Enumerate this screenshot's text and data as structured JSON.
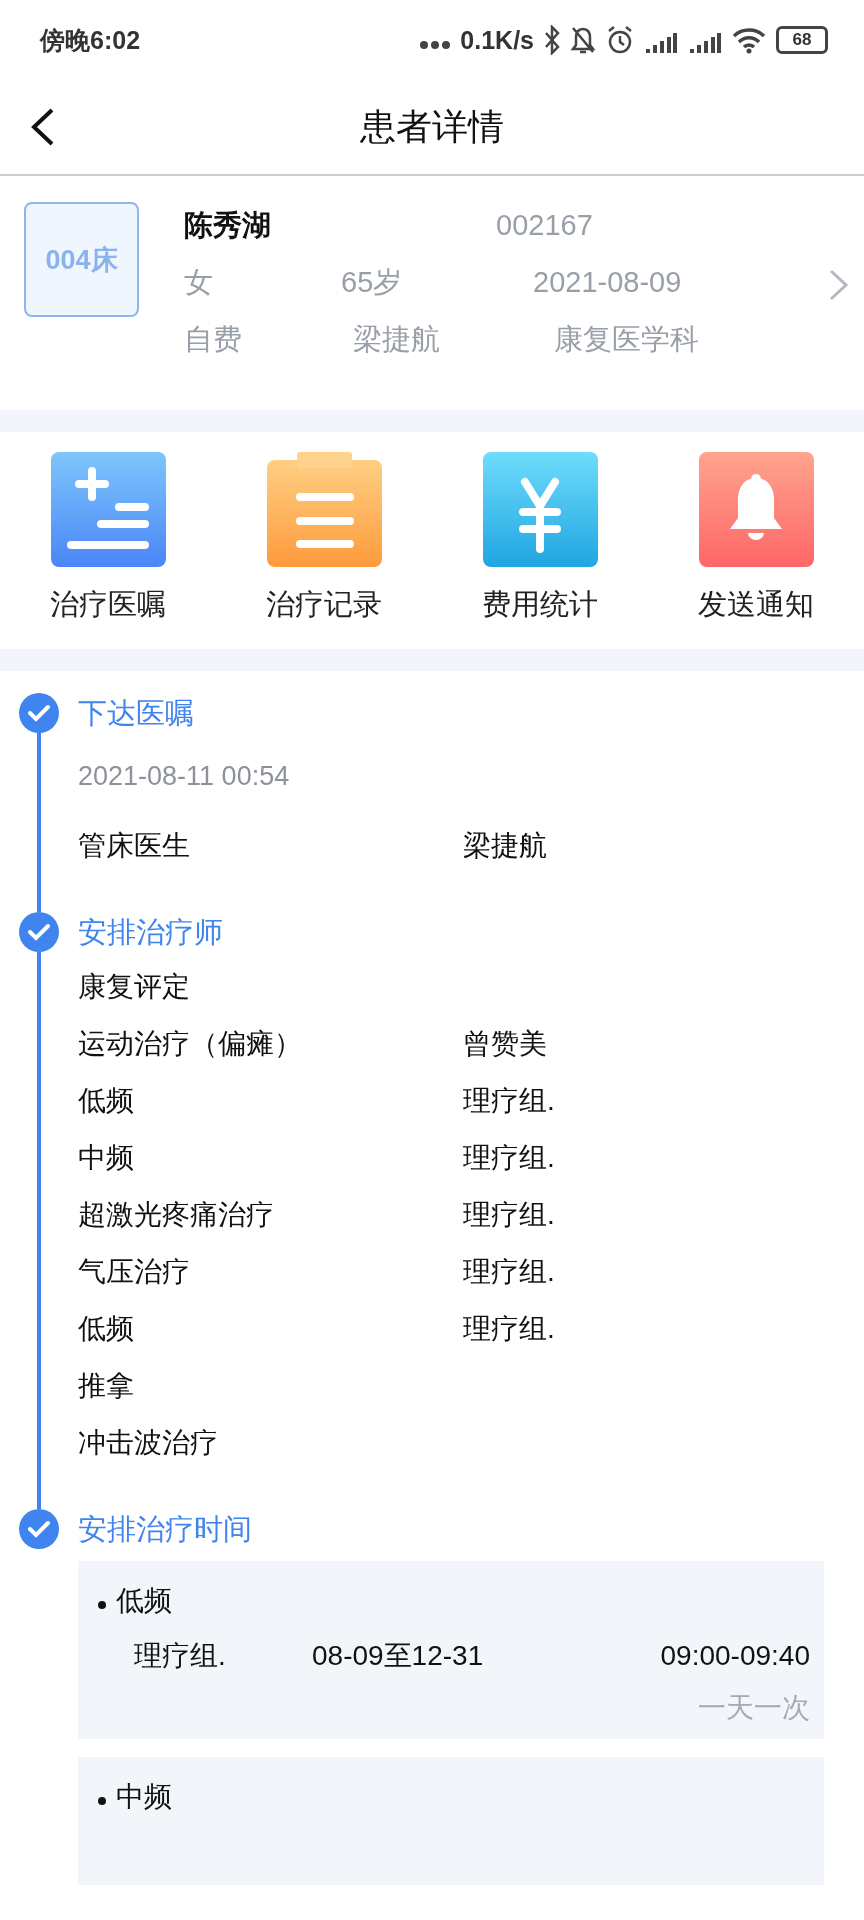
{
  "status_bar": {
    "time": "傍晚6:02",
    "net_speed": "0.1K/s",
    "battery": "68"
  },
  "header": {
    "title": "患者详情"
  },
  "patient": {
    "bed": "004床",
    "name": "陈秀湖",
    "id": "002167",
    "gender": "女",
    "age": "65岁",
    "admitted": "2021-08-09",
    "payment": "自费",
    "doctor": "梁捷航",
    "department": "康复医学科"
  },
  "actions": [
    {
      "label": "治疗医嘱",
      "kind": "orders"
    },
    {
      "label": "治疗记录",
      "kind": "records"
    },
    {
      "label": "费用统计",
      "kind": "fees"
    },
    {
      "label": "发送通知",
      "kind": "notify"
    }
  ],
  "timeline": [
    {
      "title": "下达医嘱",
      "completed": true,
      "date": "2021-08-11 00:54",
      "rows": [
        {
          "name": "管床医生",
          "value": "梁捷航"
        }
      ]
    },
    {
      "title": "安排治疗师",
      "completed": true,
      "rows": [
        {
          "name": "康复评定"
        },
        {
          "name": "运动治疗（偏瘫）",
          "value": "曾赞美"
        },
        {
          "name": "低频",
          "value": "理疗组."
        },
        {
          "name": "中频",
          "value": "理疗组."
        },
        {
          "name": "超激光疼痛治疗",
          "value": "理疗组."
        },
        {
          "name": "气压治疗",
          "value": "理疗组."
        },
        {
          "name": "低频",
          "value": "理疗组."
        },
        {
          "name": "推拿"
        },
        {
          "name": "冲击波治疗"
        }
      ]
    },
    {
      "title": "安排治疗时间",
      "completed": true,
      "schedules": [
        {
          "name": "低频",
          "therapist": "理疗组.",
          "dates": "08-09至12-31",
          "time": "09:00-09:40",
          "frequency": "一天一次"
        },
        {
          "name": "中频"
        }
      ]
    }
  ]
}
